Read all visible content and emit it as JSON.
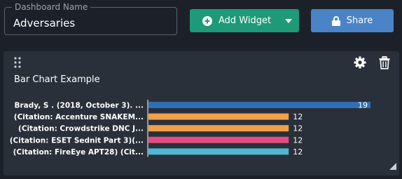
{
  "header": {
    "name_label": "Dashboard Name",
    "name_value": "Adversaries",
    "add_widget_label": "Add Widget",
    "share_label": "Share"
  },
  "panel": {
    "title": "Bar Chart Example"
  },
  "colors": {
    "background": "#1c2129",
    "panel": "#2a303a",
    "add_button": "#1e9a78",
    "share_button": "#4a84c7"
  },
  "icons": [
    "plus-circle-icon",
    "chevron-down-icon",
    "lock-icon",
    "drag-handle-icon",
    "gear-icon",
    "trash-icon",
    "resize-icon"
  ],
  "chart_data": {
    "type": "bar",
    "orientation": "horizontal",
    "categories": [
      "Brady, S . (2018, October 3). ...",
      "(Citation: Accenture SNAKEM...",
      " (Citation: Crowdstrike DNC J...",
      "(Citation: ESET Sednit Part 3)(...",
      "(Citation: FireEye APT28) (Cit..."
    ],
    "values": [
      19,
      12,
      12,
      12,
      12
    ],
    "colors": [
      "#2f6fb5",
      "#f0a04b",
      "#f0a04b",
      "#e14d7e",
      "#4fb7d3"
    ],
    "data_labels": [
      "19",
      "12",
      "12",
      "12",
      "12"
    ],
    "xlim": [
      0,
      19
    ],
    "grid": false,
    "legend": "none"
  }
}
